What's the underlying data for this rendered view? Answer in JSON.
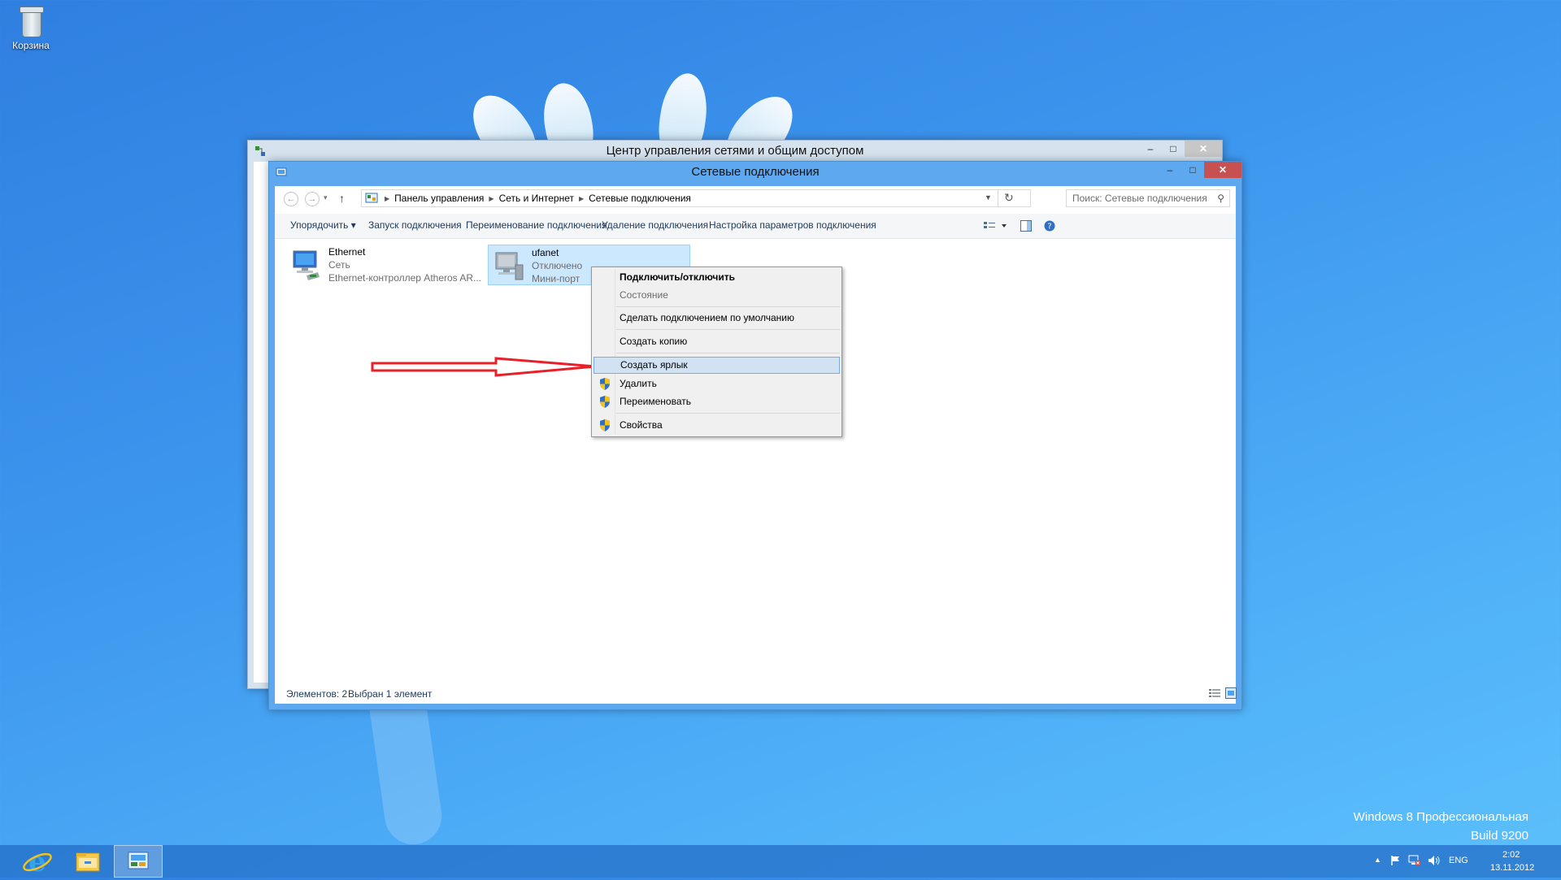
{
  "desktop": {
    "recycle_bin_label": "Корзина",
    "watermark_line1": "Windows 8 Профессиональная",
    "watermark_line2": "Build 9200"
  },
  "back_window": {
    "title": "Центр управления сетями и общим доступом",
    "buttons": [
      "–",
      "□",
      "✕"
    ]
  },
  "front_window": {
    "title": "Сетевые подключения",
    "buttons": [
      "–",
      "□",
      "✕"
    ],
    "nav": {
      "back": "←",
      "forward": "→",
      "dropdown": "▾",
      "up": "↑"
    },
    "breadcrumb": [
      "Панель управления",
      "Сеть и Интернет",
      "Сетевые подключения"
    ],
    "search_placeholder": "Поиск: Сетевые подключения",
    "commands": {
      "organize": "Упорядочить ▾",
      "start": "Запуск подключения",
      "rename": "Переименование подключения",
      "delete": "Удаление подключения",
      "settings": "Настройка параметров подключения"
    },
    "items": [
      {
        "name": "Ethernet",
        "line2": "Сеть",
        "line3": "Ethernet-контроллер Atheros AR..."
      },
      {
        "name": "ufanet",
        "line2": "Отключено",
        "line3": "Мини-порт"
      }
    ],
    "status": {
      "count": "Элементов: 2",
      "selected": "Выбран 1 элемент"
    }
  },
  "context_menu": {
    "items": [
      {
        "label": "Подключить/отключить",
        "style": "bold"
      },
      {
        "label": "Состояние",
        "style": "disabled"
      },
      {
        "label": "Сделать подключением по умолчанию"
      },
      {
        "label": "Создать копию"
      },
      {
        "label": "Создать ярлык",
        "style": "highlighted"
      },
      {
        "label": "Удалить",
        "shield": true
      },
      {
        "label": "Переименовать",
        "shield": true
      },
      {
        "label": "Свойства",
        "shield": true
      }
    ]
  },
  "taskbar": {
    "lang": "ENG",
    "time": "2:02",
    "date": "13.11.2012"
  },
  "colors": {
    "accent": "#5ea8f0",
    "selection": "#cce8ff",
    "annotation_arrow": "#e8202a"
  }
}
